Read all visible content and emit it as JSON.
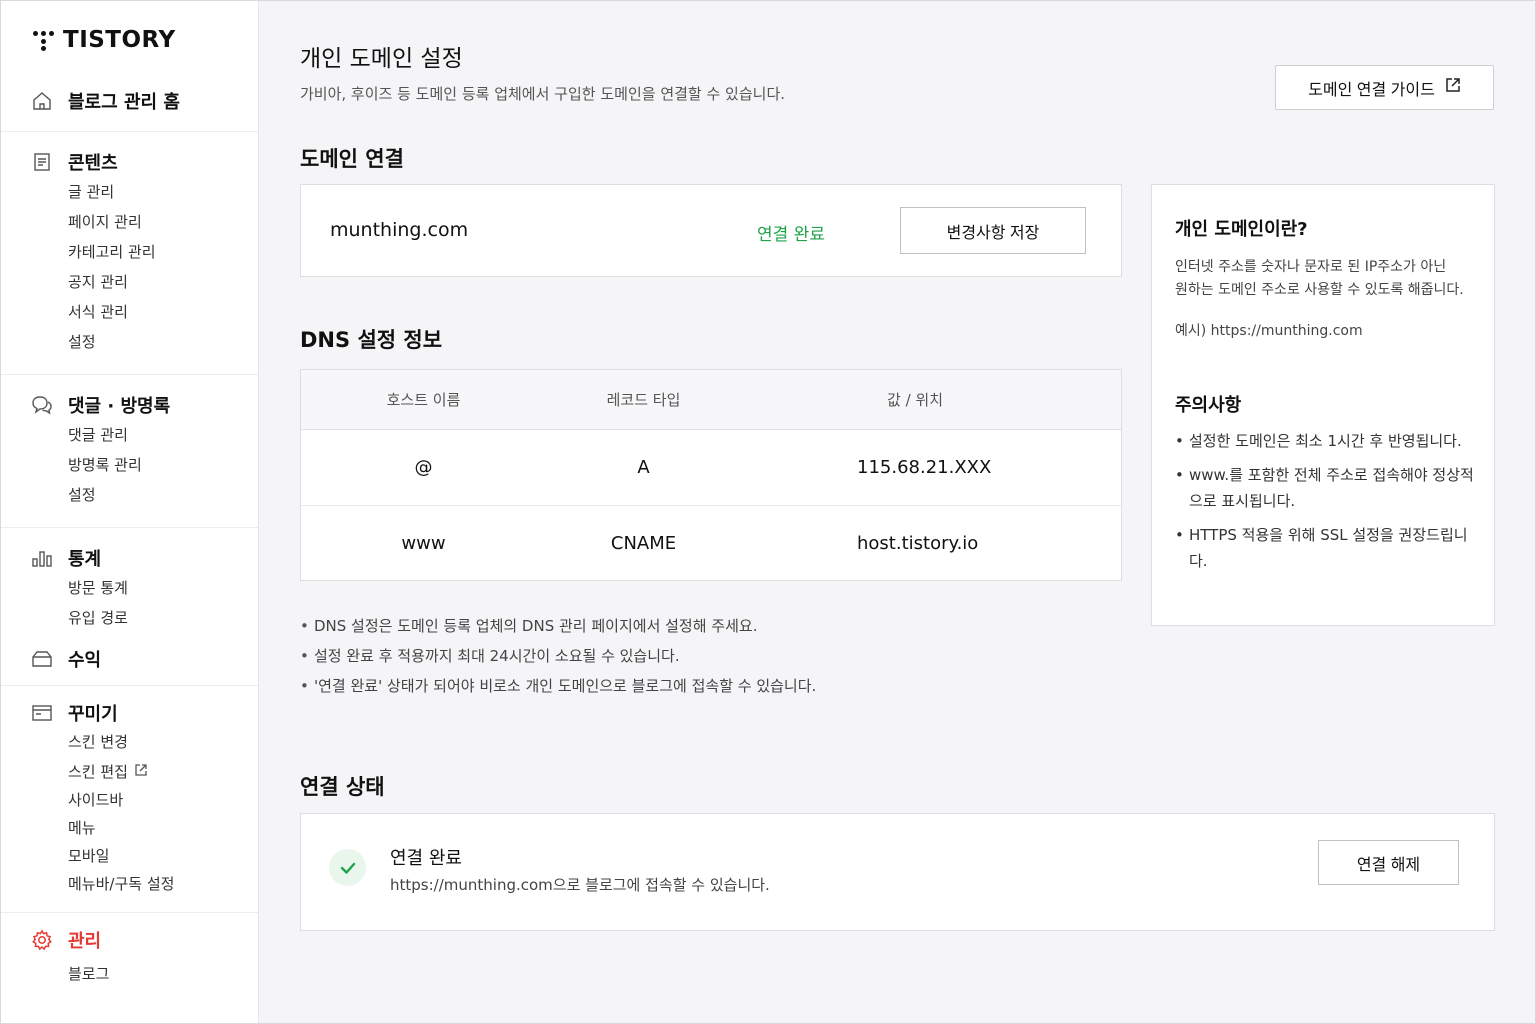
{
  "logo": {
    "text": "TISTORY"
  },
  "sidebar": {
    "home": {
      "label": "블로그 관리 홈",
      "icon": "home-icon"
    },
    "groups": [
      {
        "title": "콘텐츠",
        "icon": "document-icon",
        "items": [
          "글 관리",
          "페이지 관리",
          "카테고리 관리",
          "공지 관리",
          "서식 관리",
          "설정"
        ]
      },
      {
        "title": "댓글 · 방명록",
        "icon": "comment-icon",
        "items": [
          "댓글 관리",
          "방명록 관리",
          "설정"
        ]
      },
      {
        "title": "통계",
        "icon": "chart-icon",
        "items": [
          "방문 통계",
          "유입 경로"
        ]
      },
      {
        "title": "수익",
        "icon": "wallet-icon",
        "items": []
      },
      {
        "title": "꾸미기",
        "icon": "layout-icon",
        "items": [
          "스킨 변경",
          "스킨 편집",
          "사이드바",
          "메뉴",
          "모바일",
          "메뉴바/구독 설정"
        ]
      },
      {
        "title": "관리",
        "icon": "gear-icon",
        "items": [
          "블로그"
        ]
      }
    ]
  },
  "header": {
    "title": "개인 도메인 설정",
    "description": "가비아, 후이즈 등 도메인 등록 업체에서 구입한 도메인을 연결할 수 있습니다.",
    "guide_button": "도메인 연결 가이드"
  },
  "domain": {
    "section_title": "도메인 연결",
    "name": "munthing.com",
    "status": "연결 완료",
    "save_button": "변경사항 저장"
  },
  "dns": {
    "section_title": "DNS 설정 정보",
    "columns": [
      "호스트 이름",
      "레코드 타입",
      "값 / 위치"
    ],
    "rows": [
      [
        "@",
        "A",
        "115.68.21.XXX"
      ],
      [
        "www",
        "CNAME",
        "host.tistory.io"
      ]
    ],
    "notes": [
      "DNS 설정은 도메인 등록 업체의 DNS 관리 페이지에서 설정해 주세요.",
      "설정 완료 후 적용까지 최대 24시간이 소요될 수 있습니다.",
      "'연결 완료' 상태가 되어야 비로소 개인 도메인으로 블로그에 접속할 수 있습니다."
    ]
  },
  "info": {
    "title": "개인 도메인이란?",
    "text_line1": "인터넷 주소를 숫자나 문자로 된 IP주소가 아닌",
    "text_line2": "원하는 도메인 주소로 사용할 수 있도록 해줍니다.",
    "example": "예시) https://munthing.com",
    "caution_title": "주의사항",
    "cautions": [
      "설정한 도메인은 최소 1시간 후 반영됩니다.",
      "www.를 포함한 전체 주소로 접속해야 정상적으로 표시됩니다.",
      "HTTPS 적용을 위해 SSL 설정을 권장드립니다."
    ]
  },
  "connection": {
    "section_title": "연결 상태",
    "status_title": "연결 완료",
    "status_desc": "https://munthing.com으로 블로그에 접속할 수 있습니다.",
    "disconnect_button": "연결 해제"
  },
  "colors": {
    "success": "#1fa34a",
    "active": "#e53935"
  }
}
